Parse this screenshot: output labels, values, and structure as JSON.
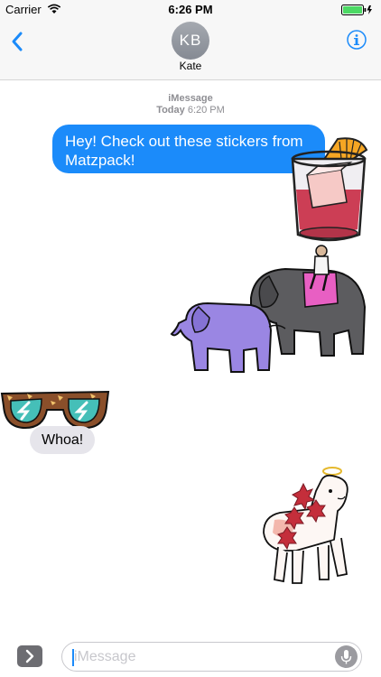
{
  "status_bar": {
    "carrier": "Carrier",
    "time": "6:26 PM"
  },
  "header": {
    "avatar_initials": "KB",
    "contact_name": "Kate"
  },
  "thread": {
    "service": "iMessage",
    "timestamp_day": "Today",
    "timestamp_time": "6:20 PM",
    "outgoing_message": "Hey! Check out these stickers from Matzpack!",
    "incoming_message": "Whoa!"
  },
  "stickers": [
    "cocktail-glass",
    "elephants-with-rider",
    "sunglasses",
    "llama-with-flowers"
  ],
  "input": {
    "placeholder": "iMessage"
  },
  "colors": {
    "accent": "#1b8bfa",
    "incoming_bubble": "#e6e5eb",
    "battery": "#4cd964",
    "elephant_purple": "#9a86e3",
    "elephant_gray": "#5c5c5f"
  }
}
